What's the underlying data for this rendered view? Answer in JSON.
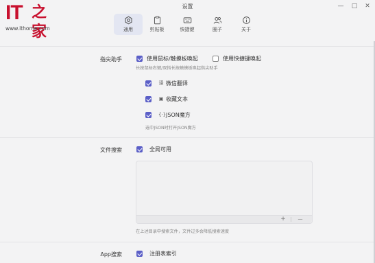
{
  "watermark": {
    "logo_it": "IT",
    "logo_cn": "之家",
    "url": "www.ithome.com"
  },
  "window": {
    "title": "设置",
    "minimize": "—",
    "maximize": "□",
    "close": "✕"
  },
  "tabs": [
    {
      "label": "通用",
      "icon": "gear-icon",
      "active": true
    },
    {
      "label": "剪贴板",
      "icon": "clipboard-icon",
      "active": false
    },
    {
      "label": "快捷键",
      "icon": "keyboard-icon",
      "active": false
    },
    {
      "label": "圈子",
      "icon": "users-icon",
      "active": false
    },
    {
      "label": "关于",
      "icon": "info-icon",
      "active": false
    }
  ],
  "fingertip": {
    "label": "指尖助手",
    "opt_mouse": "使用鼠标/触摸板唤起",
    "opt_mouse_checked": true,
    "opt_hotkey": "使用快捷键唤起",
    "opt_hotkey_checked": false,
    "hint": "长按鼠标右键/双指长按触摸板唤起指尖助手",
    "sub": [
      {
        "label": "微信翻译",
        "icon": "translate-icon",
        "checked": true
      },
      {
        "label": "收藏文本",
        "icon": "bookmark-icon",
        "checked": true
      },
      {
        "label": "JSON魔方",
        "icon": "braces-icon",
        "checked": true
      }
    ],
    "json_hint": "选中JSON时打开JSON魔方"
  },
  "file_search": {
    "label": "文件搜索",
    "global": "全局可用",
    "global_checked": true,
    "add": "+",
    "remove": "—",
    "hint": "在上述目录中搜索文件，文件过多会降低搜索速度"
  },
  "app_search": {
    "label": "App搜索",
    "registry": "注册表索引",
    "registry_checked": true
  }
}
